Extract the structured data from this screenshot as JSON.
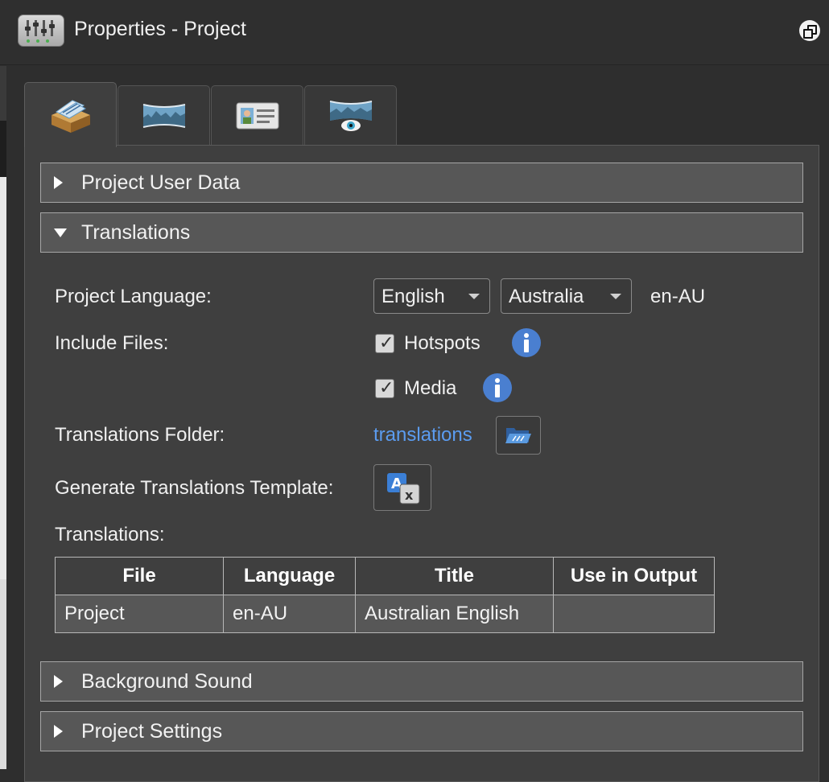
{
  "window": {
    "title": "Properties - Project"
  },
  "tabs": [
    {
      "icon": "project-box-icon"
    },
    {
      "icon": "panorama-icon"
    },
    {
      "icon": "id-card-icon"
    },
    {
      "icon": "panorama-viewer-icon"
    }
  ],
  "sections": {
    "user_data": "Project User Data",
    "translations": "Translations",
    "background_sound": "Background Sound",
    "project_settings": "Project Settings"
  },
  "translations": {
    "project_language_label": "Project Language:",
    "language_select": "English",
    "region_select": "Australia",
    "locale_code": "en-AU",
    "include_files_label": "Include Files:",
    "hotspots_label": "Hotspots",
    "hotspots_checked": true,
    "media_label": "Media",
    "media_checked": true,
    "folder_label": "Translations Folder:",
    "folder_link": "translations",
    "generate_label": "Generate Translations Template:",
    "table_label": "Translations:",
    "check_mark": "✓",
    "table": {
      "headers": [
        "File",
        "Language",
        "Title",
        "Use in Output"
      ],
      "rows": [
        [
          "Project",
          "en-AU",
          "Australian English",
          ""
        ]
      ]
    }
  }
}
